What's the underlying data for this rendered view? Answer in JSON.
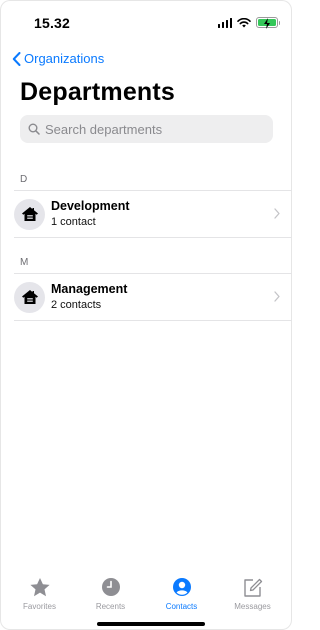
{
  "status": {
    "time": "15.32"
  },
  "nav": {
    "back_label": "Organizations",
    "title": "Departments"
  },
  "search": {
    "placeholder": "Search departments",
    "value": ""
  },
  "sections": [
    {
      "letter": "D",
      "rows": [
        {
          "title": "Development",
          "subtitle": "1 contact"
        }
      ]
    },
    {
      "letter": "M",
      "rows": [
        {
          "title": "Management",
          "subtitle": "2 contacts"
        }
      ]
    }
  ],
  "tabs": [
    {
      "label": "Favorites",
      "icon": "star-icon",
      "active": false
    },
    {
      "label": "Recents",
      "icon": "clock-icon",
      "active": false
    },
    {
      "label": "Contacts",
      "icon": "person-circle-icon",
      "active": true
    },
    {
      "label": "Messages",
      "icon": "compose-icon",
      "active": false
    }
  ],
  "colors": {
    "accent": "#0a7aff",
    "battery": "#34c759",
    "avatar_bg": "#e5e5ea",
    "search_bg": "#eeeeef"
  }
}
